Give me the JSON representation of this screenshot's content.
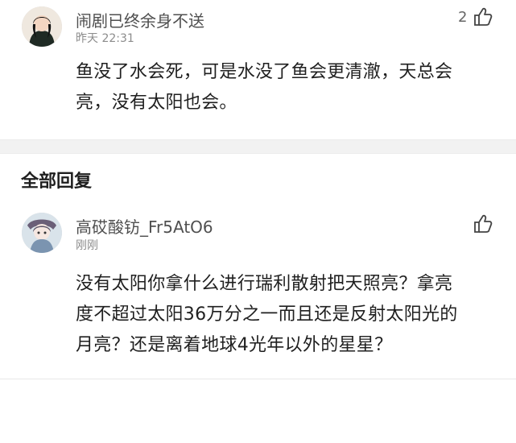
{
  "top_comment": {
    "username": "闹剧已终余身不送",
    "time": "昨天 22:31",
    "like_count": "2",
    "text_line1": "鱼没了水会死，可是水没了鱼会更清澈，天总会",
    "text_line2": "亮，没有太阳也会。",
    "avatar_icon": "user-photo-avatar",
    "like_icon": "thumb-up-icon"
  },
  "replies_section": {
    "title": "全部回复"
  },
  "reply": {
    "username": "高砹酸钫_Fr5AtO6",
    "time": "刚刚",
    "text_line1": "没有太阳你拿什么进行瑞利散射把天照亮？拿亮",
    "text_line2": "度不超过太阳36万分之一而且还是反射太阳光的",
    "text_line3": "月亮？还是离着地球4光年以外的星星？",
    "avatar_icon": "anime-avatar",
    "like_icon": "thumb-up-icon"
  }
}
